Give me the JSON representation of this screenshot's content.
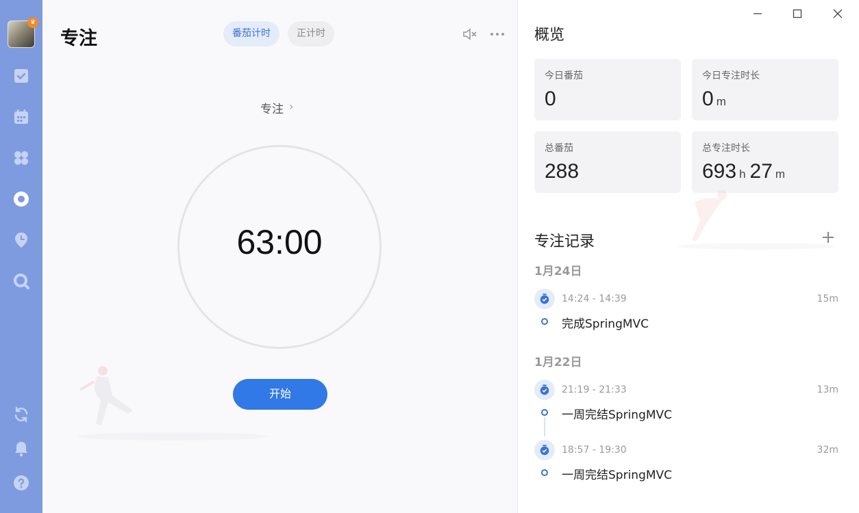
{
  "sidebar": {
    "items": [
      {
        "icon": "checkbox-icon"
      },
      {
        "icon": "calendar-icon"
      },
      {
        "icon": "quadrant-icon"
      },
      {
        "icon": "pomodoro-icon"
      },
      {
        "icon": "habit-icon"
      },
      {
        "icon": "search-icon"
      },
      {
        "icon": "sync-icon"
      },
      {
        "icon": "bell-icon"
      },
      {
        "icon": "help-icon"
      }
    ],
    "accent": "#7f9be0"
  },
  "main": {
    "title": "专注",
    "tabs": [
      {
        "label": "番茄计时",
        "active": true
      },
      {
        "label": "正计时",
        "active": false
      }
    ],
    "focus_label": "专注",
    "focus_chevron": "›",
    "timer": "63:00",
    "start_label": "开始",
    "accent": "#3079e6"
  },
  "overview": {
    "title": "概览",
    "stats": [
      {
        "label": "今日番茄",
        "value": "0",
        "unit": ""
      },
      {
        "label": "今日专注时长",
        "value": "0",
        "unit": "m"
      },
      {
        "label": "总番茄",
        "value": "288",
        "unit": ""
      },
      {
        "label": "总专注时长",
        "hours": "693",
        "hours_unit": "h",
        "minutes": "27",
        "minutes_unit": "m"
      }
    ]
  },
  "records": {
    "title": "专注记录",
    "add_symbol": "+",
    "groups": [
      {
        "date": "1月24日",
        "entries": [
          {
            "time": "14:24 - 14:39",
            "duration": "15m",
            "task": "完成SpringMVC"
          }
        ]
      },
      {
        "date": "1月22日",
        "entries": [
          {
            "time": "21:19 - 21:33",
            "duration": "13m",
            "task": "一周完结SpringMVC"
          },
          {
            "time": "18:57 - 19:30",
            "duration": "32m",
            "task": "一周完结SpringMVC"
          }
        ]
      }
    ]
  }
}
